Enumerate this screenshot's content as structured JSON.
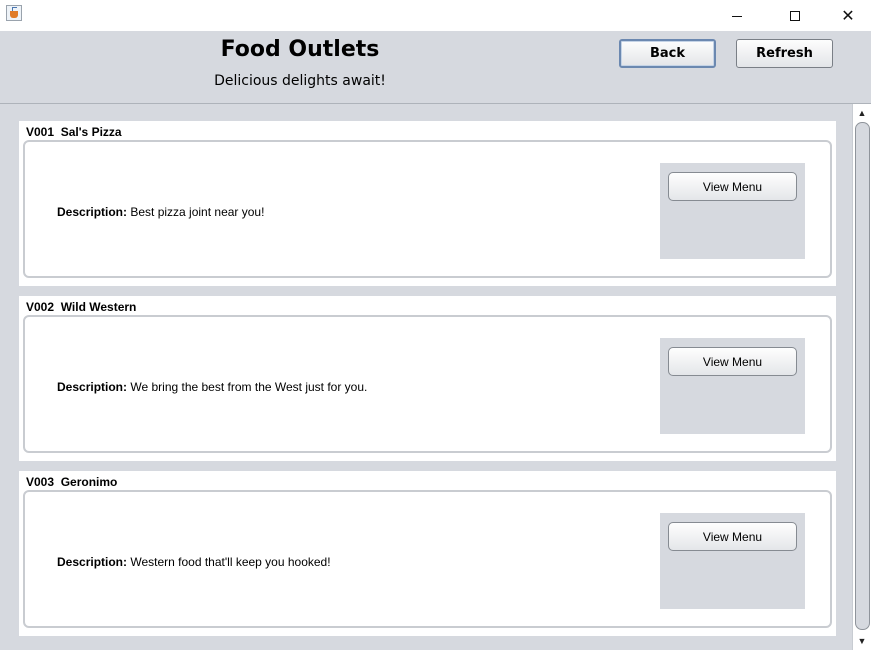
{
  "window": {
    "minimize_glyph": "",
    "close_glyph": "✕"
  },
  "header": {
    "title": "Food Outlets",
    "subtitle": "Delicious delights await!",
    "back_label": "Back",
    "refresh_label": "Refresh"
  },
  "outlets": [
    {
      "id": "V001",
      "name": "Sal's Pizza",
      "title": "V001  Sal's Pizza",
      "description_label": "Description:",
      "description": "Best pizza joint near you!",
      "button_label": "View Menu"
    },
    {
      "id": "V002",
      "name": "Wild Western",
      "title": "V002  Wild Western",
      "description_label": "Description:",
      "description": "We bring the best from the West just for you.",
      "button_label": "View Menu"
    },
    {
      "id": "V003",
      "name": "Geronimo",
      "title": "V003  Geronimo",
      "description_label": "Description:",
      "description": "Western food that'll keep you hooked!",
      "button_label": "View Menu"
    }
  ],
  "scrollbar": {
    "up_glyph": "▲",
    "down_glyph": "▼"
  },
  "colors": {
    "panel_bg": "#d6d9df",
    "card_bg": "#ffffff",
    "focus_border": "#6b88b0"
  }
}
